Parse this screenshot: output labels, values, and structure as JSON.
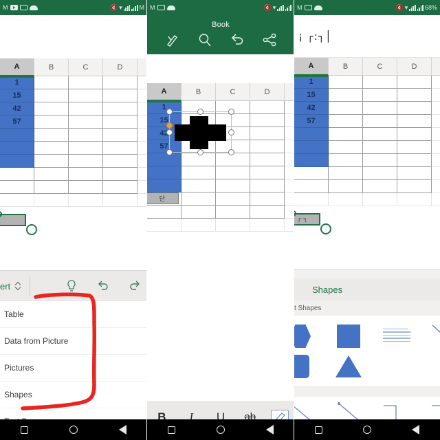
{
  "meta": {
    "app": "Microsoft Excel (Android)",
    "accent_green": "#217346",
    "header_green": "#1d6b43",
    "selection_blue": "#4472c4",
    "annotation_red": "#e8251f"
  },
  "statusbar": {
    "carrier_letter": "M",
    "icons": [
      "youtube-icon",
      "app-icon",
      "cloud-icon"
    ],
    "right_icons": [
      "mute-icon",
      "wifi-icon",
      "signal-bars-1",
      "signal-bars-2"
    ],
    "battery": "68%"
  },
  "panel_left": {
    "formula_bar_text": "",
    "sheet": {
      "columns": [
        "A",
        "B",
        "C",
        "D"
      ],
      "selected_column": "A",
      "column_a_values": [
        "1",
        "15",
        "42",
        "57",
        "",
        "",
        ""
      ],
      "selected_cell_text": ""
    },
    "ribbon": {
      "tab_label": "ert",
      "tab_full_label": "Insert",
      "icons": [
        "chevron-updown-icon",
        "lightbulb-icon",
        "undo-icon",
        "redo-icon"
      ]
    },
    "menu_items": [
      "Table",
      "Data from Picture",
      "Pictures",
      "Shapes",
      "Text Box"
    ],
    "annotation": "red-bracket-highlighting-menu"
  },
  "panel_mid": {
    "header": {
      "title": "Book",
      "icons": [
        "draw-pen-icon",
        "search-icon",
        "undo-icon",
        "share-icon"
      ]
    },
    "sheet": {
      "columns": [
        "A",
        "B",
        "C",
        "D"
      ],
      "selected_column": "A",
      "column_a_values": [
        "1",
        "15",
        "42",
        "57",
        "",
        "",
        ""
      ],
      "shape": "black-cross-shape",
      "shape_selected": true,
      "name_box_text": "단"
    },
    "format_toolbar": {
      "buttons": [
        "B",
        "I",
        "U",
        "ab",
        "highlight-icon"
      ],
      "labels": {
        "bold": "B",
        "italic": "I",
        "underline": "U",
        "strikethrough": "ab"
      }
    }
  },
  "panel_right": {
    "formula_bar_text": "¡ ┌:┐│",
    "sheet": {
      "columns": [
        "A",
        "B",
        "C",
        "D"
      ],
      "selected_column": "A",
      "column_a_values": [
        "1",
        "15",
        "42",
        "57",
        "",
        "",
        ""
      ],
      "selected_cell_text": "┌·┐"
    },
    "shapes_panel": {
      "title": "Shapes",
      "subtitle_visible": "t Shapes",
      "subtitle_full": "Recent Shapes",
      "recent_shapes": [
        "hexagon-shape",
        "square-shape",
        "text-box-shape",
        "line-shape",
        "arrow-line-shape",
        "circle-shape"
      ],
      "recent_shapes_row2": [
        "rounded-rect-shape",
        "triangle-shape"
      ],
      "lines_row": [
        "line-shape",
        "arrow-shape",
        "elbow-connector-shape",
        "elbow-connector-2-shape",
        "arrow-left-shape"
      ]
    }
  },
  "navbar": {
    "buttons": [
      "recents-button",
      "home-button",
      "back-button"
    ]
  }
}
